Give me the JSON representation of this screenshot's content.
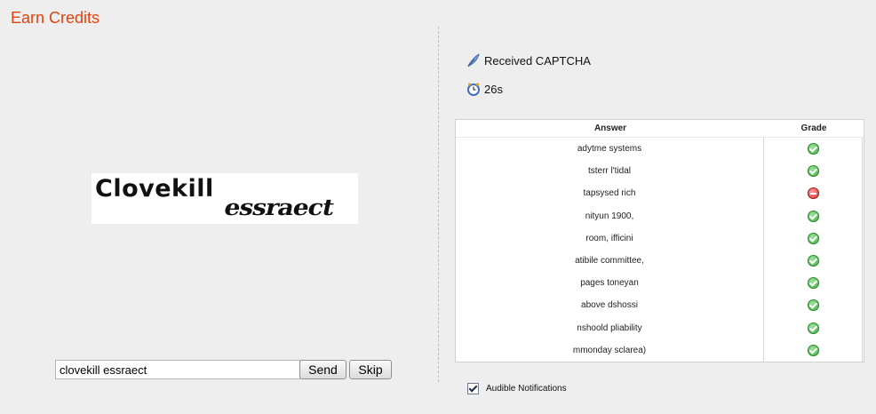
{
  "page": {
    "title": "Earn Credits"
  },
  "captcha": {
    "word1": "Clovekill",
    "word2": "essraect"
  },
  "form": {
    "answer_value": "clovekill essraect",
    "send_label": "Send",
    "skip_label": "Skip"
  },
  "status": {
    "received_label": "Received CAPTCHA",
    "received_icon": "feather-icon",
    "timer_label": "26s",
    "timer_icon": "clock-icon"
  },
  "grid": {
    "headers": {
      "answer": "Answer",
      "grade": "Grade"
    },
    "rows": [
      {
        "answer": "adytme systems",
        "grade": "correct"
      },
      {
        "answer": "tsterr l'tidal",
        "grade": "correct"
      },
      {
        "answer": "tapsysed rich",
        "grade": "incorrect"
      },
      {
        "answer": "nityun 1900,",
        "grade": "correct"
      },
      {
        "answer": "room, ifficini",
        "grade": "correct"
      },
      {
        "answer": "atibile committee,",
        "grade": "correct"
      },
      {
        "answer": "pages toneyan",
        "grade": "correct"
      },
      {
        "answer": "above dshossi",
        "grade": "correct"
      },
      {
        "answer": "nshoold pliability",
        "grade": "correct"
      },
      {
        "answer": "mmonday sclarea)",
        "grade": "correct"
      }
    ]
  },
  "settings": {
    "audible_label": "Audible Notifications",
    "audible_checked": true
  },
  "colors": {
    "title": "#e0440e",
    "correct": "#3ca83c",
    "incorrect": "#d02c2c"
  }
}
